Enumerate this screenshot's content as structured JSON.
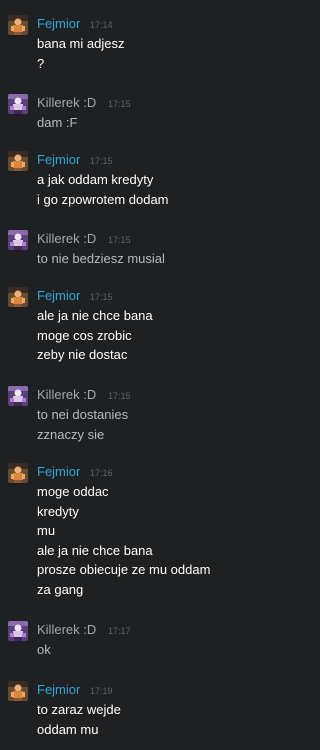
{
  "colors": {
    "background": "#1e2022",
    "fejmior_name": "#2fa6d8",
    "killerek_name": "#a0a8b0",
    "self_text": "#ffffff",
    "other_text": "#b7b9bc",
    "timestamp": "#5f6368"
  },
  "users": {
    "fejmior": {
      "name": "Fejmior",
      "avatar_icon": "orange-figure-avatar-icon"
    },
    "killerek": {
      "name": "Killerek :D",
      "avatar_icon": "purple-figure-avatar-icon"
    }
  },
  "messages": [
    {
      "author": "fejmior",
      "time": "17:14",
      "lines": [
        "bana mi adjesz",
        "?"
      ]
    },
    {
      "author": "killerek",
      "time": "17:15",
      "lines": [
        "dam :F"
      ]
    },
    {
      "author": "fejmior",
      "time": "17:15",
      "lines": [
        "a jak oddam kredyty",
        "i go zpowrotem dodam"
      ]
    },
    {
      "author": "killerek",
      "time": "17:15",
      "lines": [
        "to nie bedziesz musial"
      ]
    },
    {
      "author": "fejmior",
      "time": "17:15",
      "lines": [
        "ale ja nie chce bana",
        "moge cos zrobic",
        "zeby nie dostac"
      ]
    },
    {
      "author": "killerek",
      "time": "17:15",
      "lines": [
        "to nei dostanies",
        "zznaczy sie"
      ]
    },
    {
      "author": "fejmior",
      "time": "17:16",
      "lines": [
        "moge oddac",
        "kredyty",
        "mu",
        "ale ja nie chce bana",
        "prosze obiecuje ze mu oddam",
        "za gang"
      ]
    },
    {
      "author": "killerek",
      "time": "17:17",
      "lines": [
        "ok"
      ]
    },
    {
      "author": "fejmior",
      "time": "17:19",
      "lines": [
        "to zaraz wejde",
        "oddam mu"
      ]
    }
  ]
}
